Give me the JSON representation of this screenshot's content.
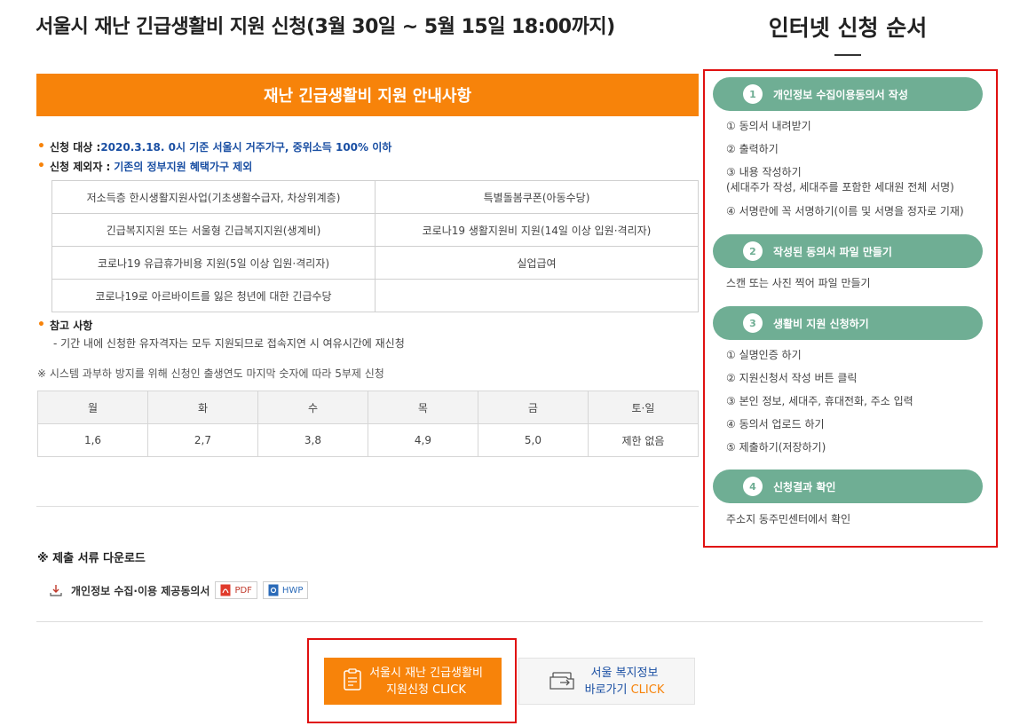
{
  "page_title": "서울시 재난 긴급생활비 지원 신청(3월 30일 ~ 5월 15일 18:00까지)",
  "notice_header": "재난 긴급생활비 지원 안내사항",
  "eligibility": {
    "label": "신청 대상 :",
    "value": "2020.3.18. 0시 기준 서울시 거주가구, 중위소득 100% 이하"
  },
  "exclusion": {
    "label": "신청 제외자 :",
    "value": "기존의 정부지원 혜택가구 제외"
  },
  "exclusion_table": [
    [
      "저소득층 한시생활지원사업(기초생활수급자, 차상위계층)",
      "특별돌봄쿠폰(아동수당)"
    ],
    [
      "긴급복지지원 또는 서울형 긴급복지지원(생계비)",
      "코로나19 생활지원비 지원(14일 이상 입원·격리자)"
    ],
    [
      "코로나19 유급휴가비용 지원(5일 이상 입원·격리자)",
      "실업급여"
    ],
    [
      "코로나19로 아르바이트를 잃은 청년에 대한 긴급수당",
      ""
    ]
  ],
  "reference": {
    "title": "참고 사항",
    "note": "- 기간 내에 신청한 유자격자는 모두 지원되므로 접속지연 시 여유시간에 재신청"
  },
  "system_note": "※ 시스템 과부하 방지를 위해 신청인 출생연도 마지막 숫자에 따라 5부제 신청",
  "day_table": {
    "headers": [
      "월",
      "화",
      "수",
      "목",
      "금",
      "토·일"
    ],
    "values": [
      "1,6",
      "2,7",
      "3,8",
      "4,9",
      "5,0",
      "제한 없음"
    ]
  },
  "download": {
    "title": "※ 제출 서류 다운로드",
    "doc_name": "개인정보 수집·이용 제공동의서",
    "pdf_label": "PDF",
    "hwp_label": "HWP"
  },
  "apply_button": {
    "line1": "서울시 재난 긴급생활비",
    "line2_prefix": "지원신청",
    "line2_click": "CLICK"
  },
  "welfare_button": {
    "line1": "서울 복지정보",
    "line2_prefix": "바로가기",
    "line2_click": "CLICK"
  },
  "right_title": "인터넷 신청 순서",
  "steps": [
    {
      "num": "1",
      "title": "개인정보 수집이용동의서 작성",
      "items": [
        "① 동의서 내려받기",
        "② 출력하기",
        "③ 내용 작성하기\n(세대주가 작성, 세대주를 포함한 세대원 전체 서명)",
        "④ 서명란에 꼭 서명하기(이름 및 서명을 정자로 기재)"
      ]
    },
    {
      "num": "2",
      "title": "작성된 동의서 파일 만들기",
      "items": [
        "스캔 또는 사진 찍어 파일 만들기"
      ]
    },
    {
      "num": "3",
      "title": "생활비 지원 신청하기",
      "items": [
        "① 실명인증 하기",
        "② 지원신청서 작성 버튼 클릭",
        "③ 본인 정보, 세대주, 휴대전화, 주소 입력",
        "④ 동의서 업로드 하기",
        "⑤ 제출하기(저장하기)"
      ]
    },
    {
      "num": "4",
      "title": "신청결과 확인",
      "items": [
        "주소지 동주민센터에서 확인"
      ]
    }
  ],
  "colors": {
    "accent_orange": "#f7830a",
    "step_green": "#6fae94",
    "highlight_red": "#e01010",
    "link_blue": "#1a4fa3"
  }
}
